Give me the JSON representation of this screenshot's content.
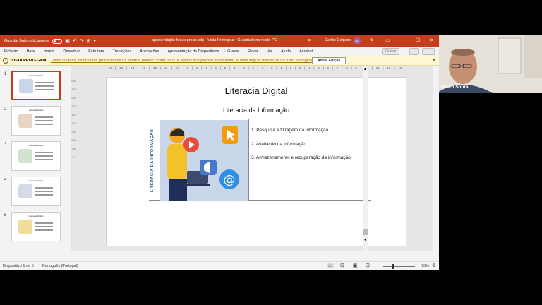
{
  "titlebar": {
    "autosave_label": "Guardar Automaticamente",
    "doc_title": "apresentação focus group.odp  -  Vista Protegida  •  Guardado no neste PC",
    "user_name": "Carlos Delgado",
    "user_initials": "CD",
    "accent": "#c43e1c"
  },
  "menu": {
    "items": [
      "Ficheiro",
      "Base",
      "Inserir",
      "Desenhar",
      "Estrutura",
      "Transições",
      "Animações",
      "Apresentação de Diapositivos",
      "Gravar",
      "Rever",
      "Ver",
      "Ajuda",
      "Acrobat"
    ],
    "right_button": "Gravar"
  },
  "protected_view": {
    "label": "VISTA PROTEGIDA",
    "message": "Tenha cuidado, os ficheiros provenientes da Internet podem conter vírus. A menos que precise de os editar, é mais seguro manter-se na Vista Protegida.",
    "enable_button": "Ativar Edição"
  },
  "ruler": {
    "horizontal": "· 16 · | · 15 · | · 14 · | · 13 · | · 12 · | · 11 · | · 10 · | · 9 · | · 8 · | · 7 · | · 6 · | · 5 · | · 4 · | · 3 · | · 2 · | · 1 · | · 0 · | · 1 · | · 2 · | · 3 · | · 4 · | · 5 · | · 6 · | · 7 · | · 8 · | · 9 · | · 10 · | · 11 · | · 12 · | · 13 · | · 14 · | · 15 · | · 16 ·",
    "vertical": "9 8 7 6 5 4 3 2 1 0 1 2 3 4 5 6 7 8 9"
  },
  "thumbnails": [
    {
      "number": "1",
      "title": "Literacia Digital"
    },
    {
      "number": "2",
      "title": "Literacia Digital"
    },
    {
      "number": "3",
      "title": "Literacia Digital"
    },
    {
      "number": "4",
      "title": "Literacia Digital"
    },
    {
      "number": "5",
      "title": "Literacia Digital"
    }
  ],
  "slide": {
    "title": "Literacia Digital",
    "subtitle": "Literacia da Informação",
    "vertical_text": "LITERACIA DA INFORMAÇÃO",
    "bullets": [
      "1.  Pesquisa e filtragem da informação",
      "2.  Avaliação da informação",
      "3.  Armazenamento e recuperação da informação"
    ]
  },
  "status": {
    "slide_counter": "Diapositivo 1 de 5",
    "language": "Português (Portugal)",
    "zoom": "73%"
  },
  "webcam": {
    "name": "Pedro Sobral"
  }
}
